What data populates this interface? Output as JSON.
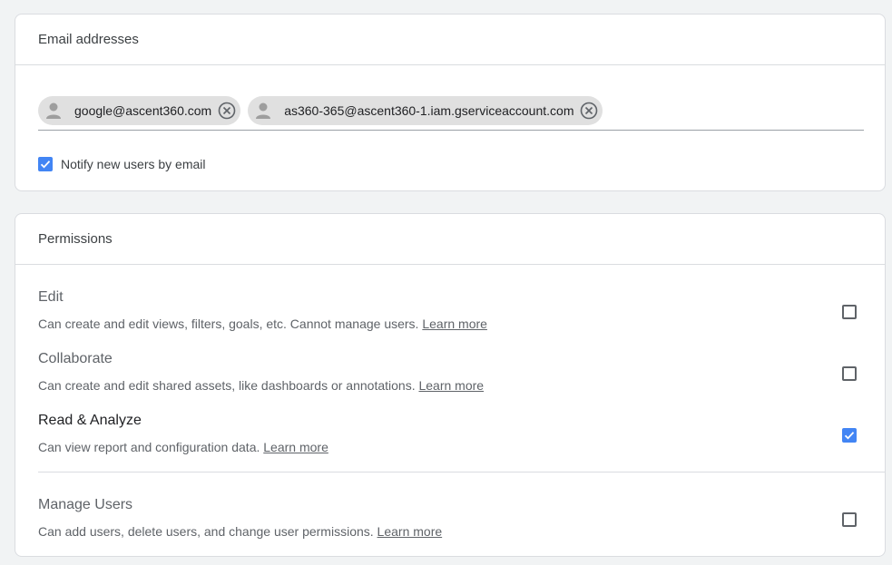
{
  "email_section": {
    "title": "Email addresses",
    "chips": [
      {
        "label": "google@ascent360.com",
        "avatar_icon": "person-icon",
        "remove_icon": "close-circle-icon"
      },
      {
        "label": "as360-365@ascent360-1.iam.gserviceaccount.com",
        "avatar_icon": "person-icon",
        "remove_icon": "close-circle-icon"
      }
    ],
    "notify_label": "Notify new users by email",
    "notify_checked": true
  },
  "permissions_section": {
    "title": "Permissions",
    "items": [
      {
        "title": "Edit",
        "description": "Can create and edit views, filters, goals, etc. Cannot manage users.",
        "link": "Learn more",
        "checked": false
      },
      {
        "title": "Collaborate",
        "description": "Can create and edit shared assets, like dashboards or annotations.",
        "link": "Learn more",
        "checked": false
      },
      {
        "title": "Read & Analyze",
        "description": "Can view report and configuration data.",
        "link": "Learn more",
        "checked": true
      },
      {
        "title": "Manage Users",
        "description": "Can add users, delete users, and change user permissions.",
        "link": "Learn more",
        "checked": false
      }
    ]
  },
  "colors": {
    "background": "#f1f3f4",
    "checkbox_accent": "#4285f4",
    "chip_bg": "#e0e0e0"
  }
}
